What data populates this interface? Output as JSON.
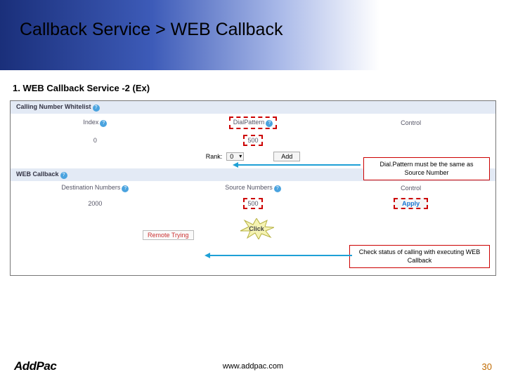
{
  "title": "Callback Service > WEB Callback",
  "subtitle": "1. WEB Callback Service -2 (Ex)",
  "panel1": {
    "band": "Calling Number Whitelist",
    "headers": {
      "index": "Index",
      "dialpattern": "DialPattern",
      "control": "Control"
    },
    "index_val": "0",
    "pattern_val": "500"
  },
  "rank": {
    "label": "Rank:",
    "value": "0",
    "btn": "Add"
  },
  "panel2": {
    "band": "WEB Callback",
    "headers": {
      "dest": "Destination Numbers",
      "src": "Source Numbers",
      "control": "Control"
    },
    "dest_val": "2000",
    "src_val": "500",
    "btn": "Apply"
  },
  "status": "Remote Trying",
  "burst": "Click",
  "callout1": "Dial.Pattern must be the same as Source Number",
  "callout2": "Check status of calling with executing WEB Callback",
  "footer": {
    "logo": "AddPac",
    "url": "www.addpac.com",
    "page": "30"
  }
}
